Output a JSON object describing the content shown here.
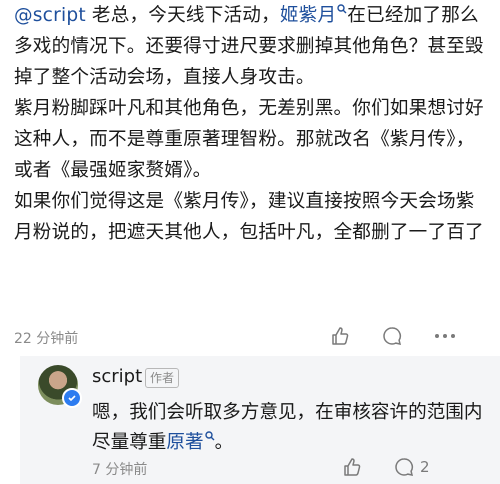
{
  "comment": {
    "mention": "@script",
    "line1_a": " 老总，今天线下活动，",
    "keyword": "姬紫月",
    "line1_b": "在已经加了那么多戏的情况下。还要得寸进尺要求删掉其他角色？甚至毁掉了整个活动会场，直接人身攻击。",
    "para2": "紫月粉脚踩叶凡和其他角色，无差别黑。你们如果想讨好这种人，而不是尊重原著理智粉。那就改名《紫月传》，或者《最强姬家赘婿》。",
    "para3": "如果你们觉得这是《紫月传》，建议直接按照今天会场紫月粉说的，把遮天其他人，包括叶凡，全都删了一了百了",
    "time": "22 分钟前",
    "like_count": "",
    "comment_count": ""
  },
  "reply": {
    "username": "script",
    "badge": "作者",
    "text_a": "嗯，我们会听取多方意见，在审核容许的范围内尽量尊重",
    "keyword": "原著",
    "text_b": "。",
    "time": "7 分钟前",
    "like_count": "",
    "comment_count": "2"
  },
  "colors": {
    "link": "#1e4f9c",
    "reply_bg": "#f4f5f7",
    "meta": "#8a8a8a",
    "verified": "#2d7cf0"
  }
}
